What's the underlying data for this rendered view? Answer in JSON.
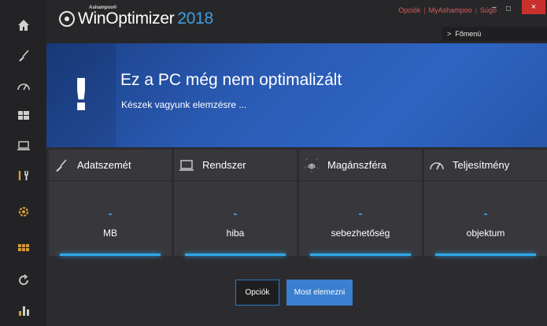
{
  "app": {
    "brand_small": "Ashampoo®",
    "brand_name": "WinOptimizer",
    "brand_year": "2018"
  },
  "topmenu": {
    "options": "Opciók",
    "myashampoo": "MyAshampoo",
    "help": "Súgó",
    "separator": "|"
  },
  "window": {
    "minimize": "–",
    "maximize": "□",
    "close": "×"
  },
  "fomenu": {
    "arrow": ">",
    "label": "Főmenü"
  },
  "sidebar": {
    "items": [
      {
        "icon": "home-icon"
      },
      {
        "icon": "broom-icon"
      },
      {
        "icon": "speedometer-icon"
      },
      {
        "icon": "windows-icon"
      },
      {
        "icon": "laptop-icon"
      },
      {
        "icon": "tools-icon"
      },
      {
        "icon": "gear-icon"
      },
      {
        "icon": "grid-icon"
      },
      {
        "icon": "refresh-icon"
      },
      {
        "icon": "stats-icon"
      }
    ]
  },
  "banner": {
    "symbol": "!",
    "title": "Ez a PC még nem optimalizált",
    "subtitle": "Készek vagyunk elemzésre ..."
  },
  "cards": [
    {
      "title": "Adatszemét",
      "value": "-",
      "unit": "MB",
      "icon": "broom-icon"
    },
    {
      "title": "Rendszer",
      "value": "-",
      "unit": "hiba",
      "icon": "laptop-icon"
    },
    {
      "title": "Magánszféra",
      "value": "-",
      "unit": "sebezhetőség",
      "icon": "fingerprint-icon"
    },
    {
      "title": "Teljesítmény",
      "value": "-",
      "unit": "objektum",
      "icon": "speedometer-icon"
    }
  ],
  "actions": {
    "options": "Opciók",
    "scan": "Most elemezni"
  },
  "colors": {
    "accent": "#2ea8e8",
    "banner": "#2a5ab3",
    "close": "#c9302c",
    "menu_link": "#e05a5a"
  }
}
